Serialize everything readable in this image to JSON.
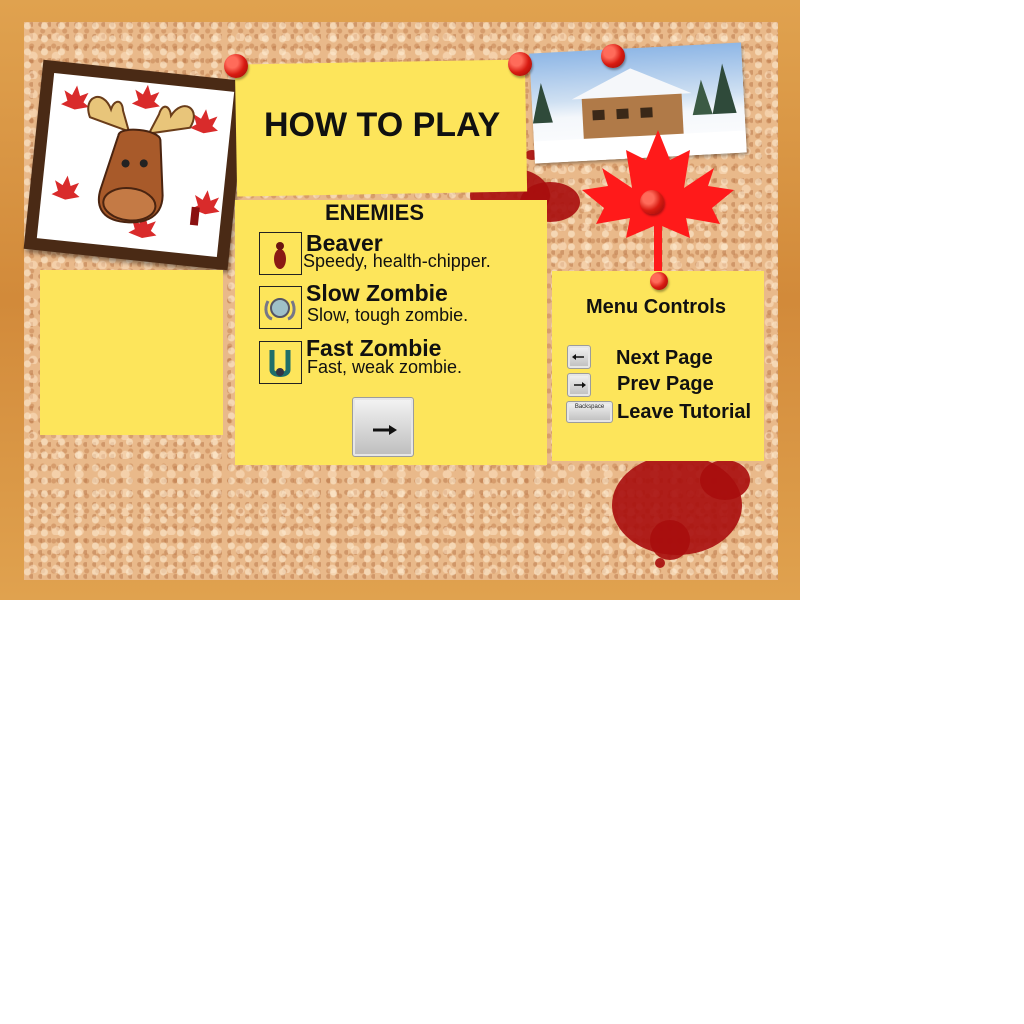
{
  "board": {
    "title": "HOW TO PLAY"
  },
  "enemies": {
    "heading": "ENEMIES",
    "list": [
      {
        "name": "Beaver",
        "description": "Speedy, health-chipper.",
        "icon": "beaver-icon"
      },
      {
        "name": "Slow Zombie",
        "description": "Slow, tough zombie.",
        "icon": "slow-zombie-icon"
      },
      {
        "name": "Fast Zombie",
        "description": "Fast, weak zombie.",
        "icon": "fast-zombie-icon"
      }
    ],
    "next_key_icon": "right-arrow-key-icon"
  },
  "menu": {
    "heading": "Menu Controls",
    "controls": [
      {
        "label": "Next Page",
        "key_icon": "left-arrow-key-icon"
      },
      {
        "label": "Prev Page",
        "key_icon": "right-arrow-key-icon"
      },
      {
        "label": "Leave Tutorial",
        "key_icon": "backspace-key-icon",
        "key_text": "Backspace"
      }
    ]
  },
  "colors": {
    "note": "#fde55b",
    "cork": "#e9b98a",
    "frame": "#d28a3a",
    "blood": "#a80d0d",
    "maple": "#ff1a1a"
  }
}
